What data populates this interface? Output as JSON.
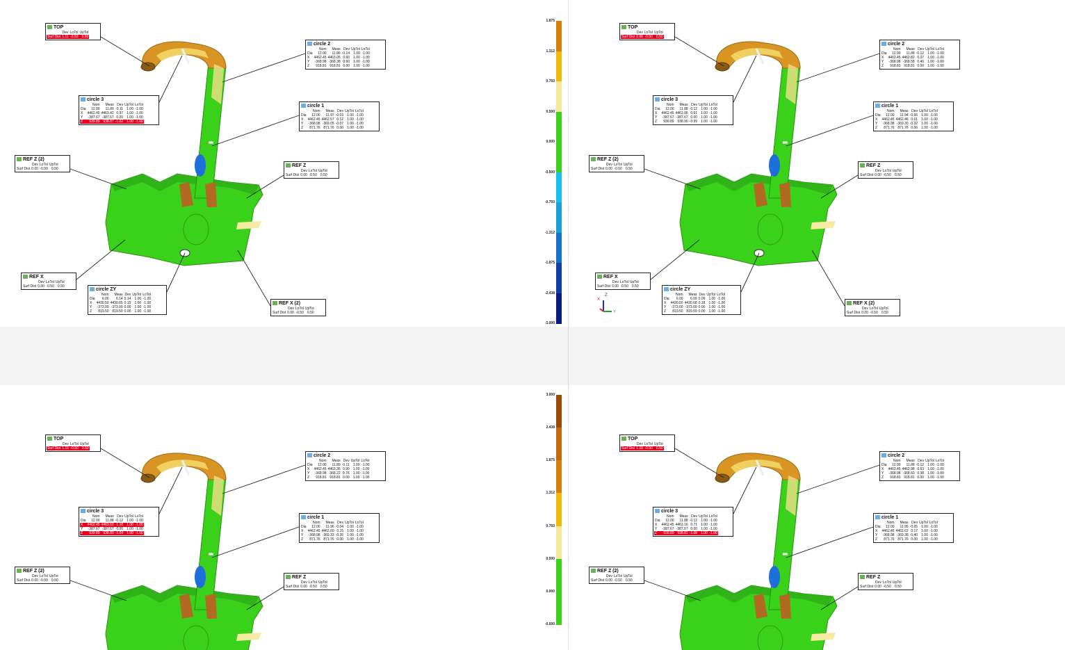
{
  "colors": {
    "ok": "#e8001c",
    "panel_bg": "#ffffff",
    "model_green": "#39d11a",
    "accent_orange": "#d99524",
    "accent_blue": "#1e6fd9"
  },
  "headers": {
    "dev": "Dev",
    "lotol": "LoTol",
    "uptol": "UpTol",
    "nom": "Nom",
    "meas": "Meas",
    "surf_dist": "Surf Dist",
    "dia": "Dia",
    "x": "X",
    "y": "Y",
    "z": "Z"
  },
  "panels": [
    {
      "id": "top-left",
      "top": {
        "title": "TOP",
        "dev": "1.11",
        "lo": "-0.50",
        "up": "0.50",
        "bad": true
      },
      "circle2": {
        "title": "circle 2",
        "rows": [
          [
            "Dia",
            "12.00",
            "11.86",
            "-0.14",
            "1.00",
            "-1.00"
          ],
          [
            "X",
            "4462.45",
            "4463.05",
            "0.60",
            "1.00",
            "-1.00"
          ],
          [
            "Y",
            "-368.98",
            "-368.38",
            "0.60",
            "1.00",
            "-1.00"
          ],
          [
            "Z",
            "918.81",
            "918.81",
            "0.00",
            "1.00",
            "-1.00"
          ]
        ]
      },
      "circle3": {
        "title": "circle 3",
        "rows": [
          [
            "Dia",
            "12.00",
            "11.89",
            "-0.11",
            "1.00",
            "-1.00"
          ],
          [
            "X",
            "4462.45",
            "4463.42",
            "0.97",
            "1.00",
            "-1.00"
          ],
          [
            "Y",
            "-387.67",
            "-387.67",
            "0.00",
            "1.00",
            "-1.00"
          ],
          [
            "Z",
            "939.89",
            "938.87",
            "-1.02",
            "1.00",
            "-1.00"
          ]
        ],
        "bad_rows": [
          3
        ]
      },
      "circle1": {
        "title": "circle 1",
        "rows": [
          [
            "Dia",
            "12.00",
            "11.97",
            "-0.03",
            "1.00",
            "-1.00"
          ],
          [
            "X",
            "4462.45",
            "4462.57",
            "0.12",
            "1.00",
            "-1.00"
          ],
          [
            "Y",
            "-368.98",
            "-369.05",
            "-0.07",
            "1.00",
            "-1.00"
          ],
          [
            "Z",
            "871.76",
            "871.76",
            "0.00",
            "1.00",
            "-1.00"
          ]
        ]
      },
      "refz2": {
        "title": "REF Z (2)",
        "dev": "0.00",
        "lo": "-0.50",
        "up": "0.50"
      },
      "refz": {
        "title": "REF Z",
        "dev": "0.00",
        "lo": "-0.50",
        "up": "0.50"
      },
      "refx": {
        "title": "REF X",
        "dev": "0.00",
        "lo": "-0.50",
        "up": "0.50"
      },
      "circlezy": {
        "title": "circle ZY",
        "rows": [
          [
            "Dia",
            "6.00",
            "6.14",
            "0.14",
            "1.00",
            "-1.00"
          ],
          [
            "X",
            "4430.50",
            "4430.65",
            "0.15",
            "1.00",
            "-1.00"
          ],
          [
            "Y",
            "-373.00",
            "-373.00",
            "0.00",
            "1.00",
            "-1.00"
          ],
          [
            "Z",
            "819.50",
            "819.50",
            "0.00",
            "1.00",
            "-1.00"
          ]
        ]
      },
      "refx2": {
        "title": "REF X (2)",
        "dev": "0.00",
        "lo": "-0.50",
        "up": "0.50"
      }
    },
    {
      "id": "top-right",
      "top": {
        "title": "TOP",
        "dev": "0.98",
        "lo": "-0.50",
        "up": "0.50",
        "bad": true
      },
      "circle2": {
        "title": "circle 2",
        "rows": [
          [
            "Dia",
            "12.00",
            "11.88",
            "-0.12",
            "1.00",
            "-1.00"
          ],
          [
            "X",
            "4462.45",
            "4462.82",
            "0.37",
            "1.00",
            "-1.00"
          ],
          [
            "Y",
            "-368.98",
            "-368.58",
            "0.40",
            "1.00",
            "-1.00"
          ],
          [
            "Z",
            "918.81",
            "918.81",
            "0.00",
            "1.00",
            "-1.00"
          ]
        ]
      },
      "circle3": {
        "title": "circle 3",
        "rows": [
          [
            "Dia",
            "12.00",
            "11.88",
            "-0.12",
            "1.00",
            "-1.00"
          ],
          [
            "X",
            "4462.45",
            "4463.06",
            "0.61",
            "1.00",
            "-1.00"
          ],
          [
            "Y",
            "-387.67",
            "-387.67",
            "0.00",
            "1.00",
            "-1.00"
          ],
          [
            "Z",
            "939.89",
            "938.90",
            "-0.99",
            "1.00",
            "-1.00"
          ]
        ],
        "bad_rows": []
      },
      "circle1": {
        "title": "circle 1",
        "rows": [
          [
            "Dia",
            "12.00",
            "11.94",
            "-0.06",
            "1.00",
            "-1.00"
          ],
          [
            "X",
            "4462.45",
            "4462.46",
            "0.01",
            "1.00",
            "-1.00"
          ],
          [
            "Y",
            "-368.98",
            "-369.30",
            "-0.32",
            "1.00",
            "-1.00"
          ],
          [
            "Z",
            "871.76",
            "871.76",
            "0.00",
            "1.00",
            "-1.00"
          ]
        ]
      },
      "refz2": {
        "title": "REF Z (2)",
        "dev": "0.00",
        "lo": "-0.50",
        "up": "0.50"
      },
      "refz": {
        "title": "REF Z",
        "dev": "0.00",
        "lo": "-0.50",
        "up": "0.50"
      },
      "refx": {
        "title": "REF X",
        "dev": "0.00",
        "lo": "-0.50",
        "up": "0.50"
      },
      "circlezy": {
        "title": "circle ZY",
        "rows": [
          [
            "Dia",
            "6.00",
            "6.09",
            "0.09",
            "1.00",
            "-1.00"
          ],
          [
            "X",
            "4430.50",
            "4430.68",
            "0.18",
            "1.00",
            "-1.00"
          ],
          [
            "Y",
            "-373.00",
            "-373.00",
            "0.00",
            "1.00",
            "-1.00"
          ],
          [
            "Z",
            "819.50",
            "819.50",
            "0.00",
            "1.00",
            "-1.00"
          ]
        ]
      },
      "refx2": {
        "title": "REF X (2)",
        "dev": "0.00",
        "lo": "-0.50",
        "up": "0.50"
      }
    },
    {
      "id": "bottom-left",
      "top": {
        "title": "TOP",
        "dev": "1.15",
        "lo": "-0.50",
        "up": "0.50",
        "bad": true
      },
      "circle2": {
        "title": "circle 2",
        "rows": [
          [
            "Dia",
            "12.00",
            "11.89",
            "-0.11",
            "1.00",
            "-1.00"
          ],
          [
            "X",
            "4462.45",
            "4463.35",
            "0.90",
            "1.00",
            "-1.00"
          ],
          [
            "Y",
            "-368.98",
            "-368.22",
            "0.76",
            "1.00",
            "-1.00"
          ],
          [
            "Z",
            "918.81",
            "918.81",
            "0.00",
            "1.00",
            "-1.00"
          ]
        ]
      },
      "circle3": {
        "title": "circle 3",
        "rows": [
          [
            "Dia",
            "12.00",
            "11.88",
            "-0.12",
            "1.00",
            "-1.00"
          ],
          [
            "X",
            "4462.45",
            "4463.63",
            "1.18",
            "1.00",
            "-1.00"
          ],
          [
            "Y",
            "-387.67",
            "-387.67",
            "0.00",
            "1.00",
            "-1.00"
          ],
          [
            "Z",
            "939.89",
            "938.80",
            "-1.09",
            "1.00",
            "-1.00"
          ]
        ],
        "bad_rows": [
          1,
          3
        ]
      },
      "circle1": {
        "title": "circle 1",
        "rows": [
          [
            "Dia",
            "12.00",
            "11.96",
            "-0.04",
            "1.00",
            "-1.00"
          ],
          [
            "X",
            "4462.45",
            "4462.60",
            "0.15",
            "1.00",
            "-1.00"
          ],
          [
            "Y",
            "-368.98",
            "-369.33",
            "-0.35",
            "1.00",
            "-1.00"
          ],
          [
            "Z",
            "871.76",
            "871.76",
            "0.00",
            "1.00",
            "-1.00"
          ]
        ]
      },
      "refz2": {
        "title": "REF Z (2)",
        "dev": "0.00",
        "lo": "-0.50",
        "up": "0.50"
      },
      "refz": {
        "title": "REF Z",
        "dev": "0.00",
        "lo": "-0.50",
        "up": "0.50"
      }
    },
    {
      "id": "bottom-right",
      "top": {
        "title": "TOP",
        "dev": "1.18",
        "lo": "-0.50",
        "up": "0.50",
        "bad": true
      },
      "circle2": {
        "title": "circle 2",
        "rows": [
          [
            "Dia",
            "12.00",
            "11.88",
            "-0.12",
            "1.00",
            "-1.00"
          ],
          [
            "X",
            "4462.45",
            "4462.98",
            "0.53",
            "1.00",
            "-1.00"
          ],
          [
            "Y",
            "-368.98",
            "-368.60",
            "0.38",
            "1.00",
            "-1.00"
          ],
          [
            "Z",
            "918.81",
            "918.81",
            "0.00",
            "1.00",
            "-1.00"
          ]
        ]
      },
      "circle3": {
        "title": "circle 3",
        "rows": [
          [
            "Dia",
            "12.00",
            "11.88",
            "-0.12",
            "1.00",
            "-1.00"
          ],
          [
            "X",
            "4462.45",
            "4463.16",
            "0.71",
            "1.00",
            "-1.00"
          ],
          [
            "Y",
            "-387.67",
            "-387.67",
            "0.00",
            "1.00",
            "-1.00"
          ],
          [
            "Z",
            "939.89",
            "938.81",
            "-1.08",
            "1.00",
            "-1.00"
          ]
        ],
        "bad_rows": [
          3
        ]
      },
      "circle1": {
        "title": "circle 1",
        "rows": [
          [
            "Dia",
            "12.00",
            "11.95",
            "-0.05",
            "1.00",
            "-1.00"
          ],
          [
            "X",
            "4462.45",
            "4462.62",
            "0.17",
            "1.00",
            "-1.00"
          ],
          [
            "Y",
            "-368.98",
            "-369.38",
            "-0.40",
            "1.00",
            "-1.00"
          ],
          [
            "Z",
            "871.76",
            "871.76",
            "0.00",
            "1.00",
            "-1.00"
          ]
        ]
      },
      "refz2": {
        "title": "REF Z (2)",
        "dev": "0.00",
        "lo": "-0.50",
        "up": "0.50"
      },
      "refz": {
        "title": "REF Z",
        "dev": "0.00",
        "lo": "-0.50",
        "up": "0.50"
      }
    }
  ],
  "legend_top": {
    "labels": [
      "1.875",
      "1.312",
      "0.750",
      "0.500",
      "0.000",
      "-0.500",
      "-0.750",
      "-1.312",
      "-1.875",
      "-2.438",
      "-3.000"
    ]
  },
  "legend_bottom": {
    "labels": [
      "3.000",
      "2.438",
      "1.875",
      "1.312",
      "0.750",
      "0.500",
      "0.000",
      "-0.500"
    ]
  },
  "axes": {
    "z": "Z",
    "x": "X",
    "y": "Y"
  }
}
